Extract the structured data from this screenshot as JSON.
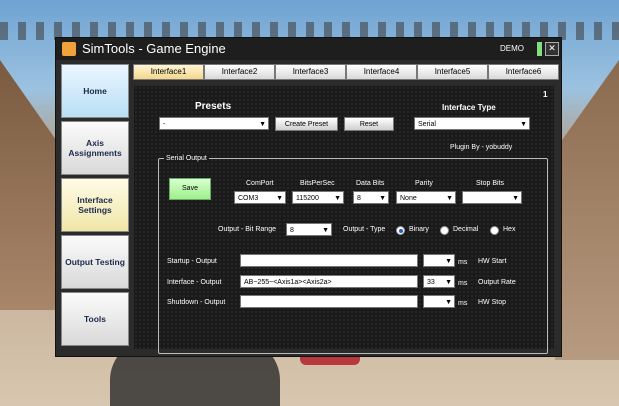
{
  "window": {
    "title": "SimTools - Game Engine",
    "demo_label": "DEMO",
    "close_glyph": "✕"
  },
  "sidebar": {
    "items": [
      {
        "label": "Home"
      },
      {
        "label": "Axis Assignments"
      },
      {
        "label": "Interface Settings"
      },
      {
        "label": "Output Testing"
      },
      {
        "label": "Tools"
      }
    ]
  },
  "tabs": [
    {
      "label": "Interface1"
    },
    {
      "label": "Interface2"
    },
    {
      "label": "Interface3"
    },
    {
      "label": "Interface4"
    },
    {
      "label": "Interface5"
    },
    {
      "label": "Interface6"
    }
  ],
  "page_number": "1",
  "presets": {
    "heading": "Presets",
    "selected": "-",
    "create_label": "Create Preset",
    "reset_label": "Reset"
  },
  "interface_type": {
    "heading": "Interface Type",
    "selected": "Serial"
  },
  "plugin": {
    "text": "Plugin By - yobuddy"
  },
  "serial_output": {
    "group_label": "Serial Output",
    "save_label": "Save",
    "comport": {
      "label": "ComPort",
      "value": "COM3"
    },
    "bits_per_sec": {
      "label": "BitsPerSec",
      "value": "115200"
    },
    "data_bits": {
      "label": "Data Bits",
      "value": "8"
    },
    "parity": {
      "label": "Parity",
      "value": "None"
    },
    "stop_bits": {
      "label": "Stop Bits",
      "value": ""
    },
    "bit_range": {
      "label": "Output - Bit Range",
      "value": "8"
    },
    "output_type": {
      "label": "Output - Type",
      "options": [
        "Binary",
        "Decimal",
        "Hex"
      ],
      "selected": "Binary"
    },
    "startup": {
      "label": "Startup - Output",
      "value": "",
      "unit": "ms",
      "side": "HW Start"
    },
    "interface": {
      "label": "Interface - Output",
      "value": "AB~255~<Axis1a><Axis2a>",
      "rate": "33",
      "unit": "ms",
      "side": "Output Rate"
    },
    "shutdown": {
      "label": "Shutdown - Output",
      "value": "",
      "unit": "ms",
      "side": "HW Stop"
    }
  }
}
